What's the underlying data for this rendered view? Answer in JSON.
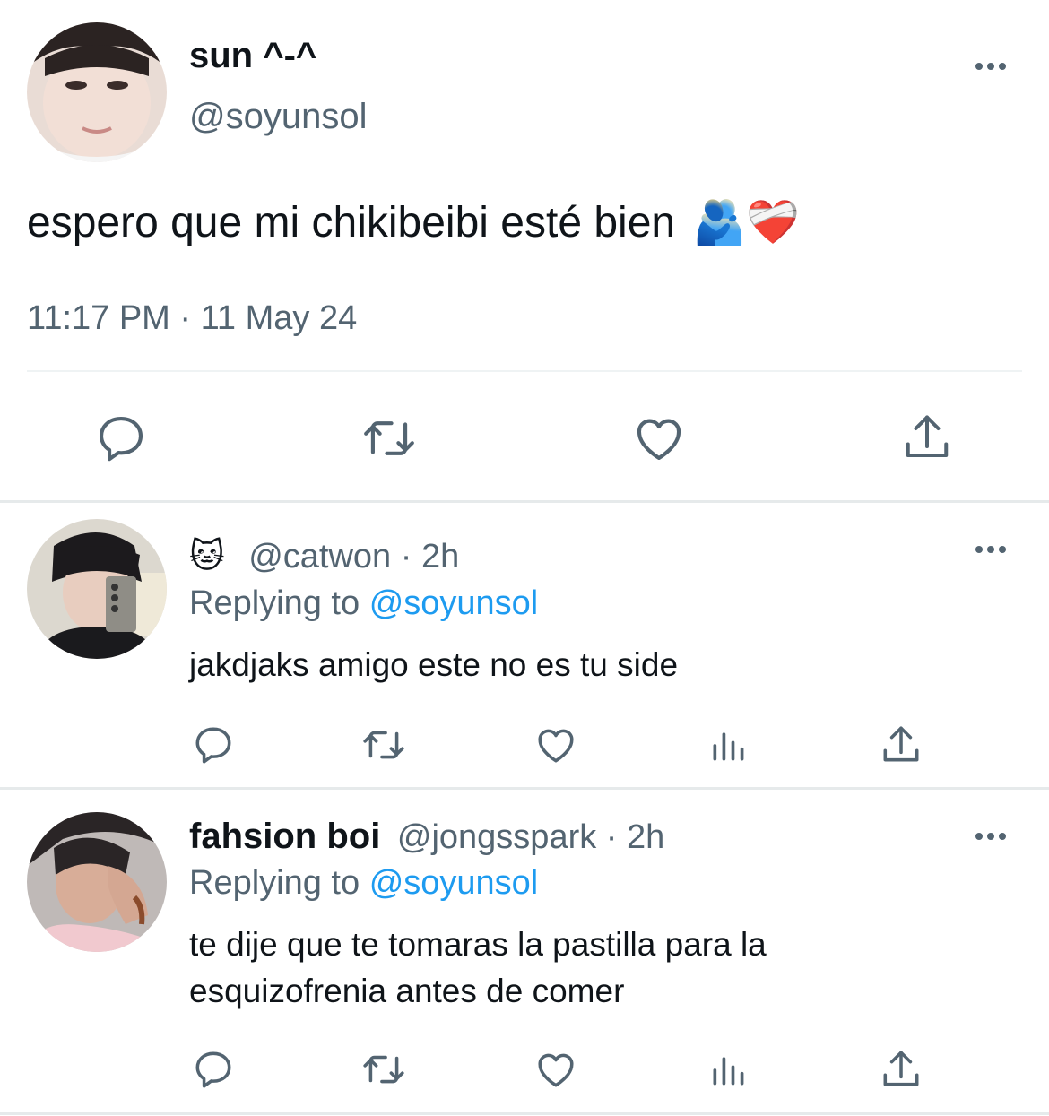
{
  "main_tweet": {
    "display_name": "sun ^-^",
    "handle": "@soyunsol",
    "text": "espero que mi chikibeibi esté bien",
    "emojis": "🫂❤️‍🩹",
    "timestamp": "11:17 PM · 11 May 24",
    "actions": [
      "reply-icon",
      "retweet-icon",
      "like-icon",
      "share-icon"
    ]
  },
  "replies": [
    {
      "name_emoji": "🐱",
      "display_name": "",
      "handle": "@catwon",
      "time": "· 2h",
      "replying_prefix": "Replying to",
      "replying_handle": "@soyunsol",
      "text": "jakdjaks amigo este no es tu side",
      "actions": [
        "reply-icon",
        "retweet-icon",
        "like-icon",
        "views-icon",
        "share-icon"
      ]
    },
    {
      "name_emoji": "",
      "display_name": "fahsion boi",
      "handle": "@jongsspark",
      "time": "· 2h",
      "replying_prefix": "Replying to",
      "replying_handle": "@soyunsol",
      "text_line1": "te dije que te tomaras la pastilla para la",
      "text_line2": "esquizofrenia antes de comer",
      "actions": [
        "reply-icon",
        "retweet-icon",
        "like-icon",
        "views-icon",
        "share-icon"
      ]
    }
  ],
  "colors": {
    "text": "#0f1419",
    "secondary": "#536471",
    "accent": "#1d9bf0",
    "divider": "#eff3f4"
  }
}
